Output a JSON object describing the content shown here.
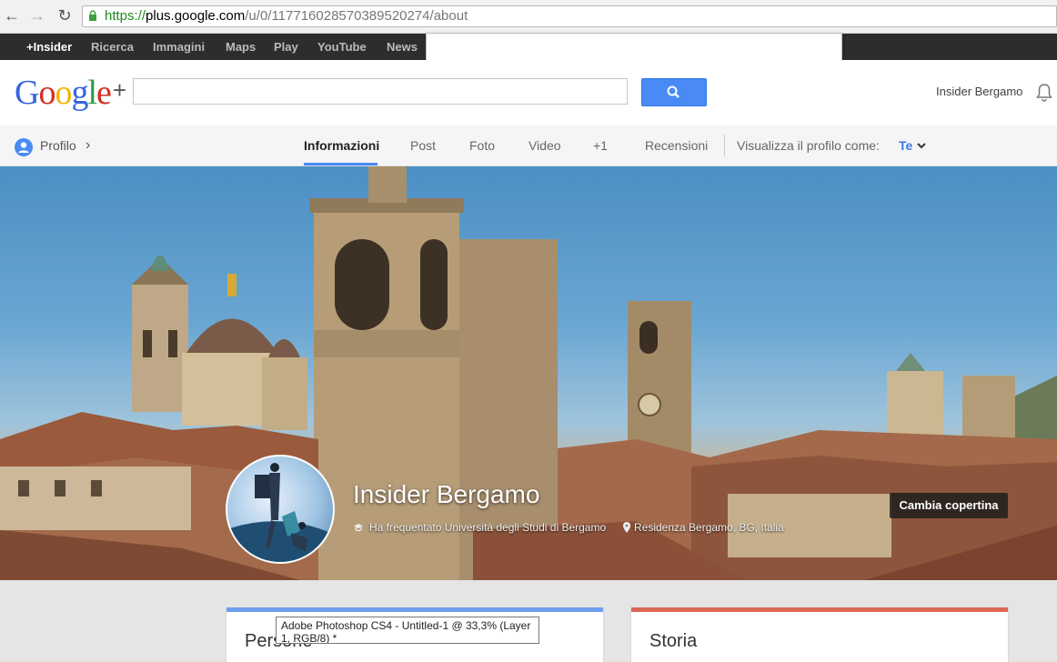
{
  "browser": {
    "back_icon": "arrow-left-icon",
    "forward_icon": "arrow-right-icon",
    "reload_icon": "reload-icon",
    "url_scheme": "https://",
    "url_host": "plus.google.com",
    "url_path": "/u/0/117716028570389520274/about"
  },
  "gbar": {
    "items": [
      "+Insider",
      "Ricerca",
      "Immagini",
      "Maps",
      "Play",
      "YouTube",
      "News"
    ]
  },
  "header": {
    "logo_letters": [
      "G",
      "o",
      "o",
      "g",
      "l",
      "e"
    ],
    "logo_plus": "+",
    "search_placeholder": "",
    "username": "Insider Bergamo"
  },
  "nav": {
    "profile_label": "Profilo",
    "tabs": [
      "Informazioni",
      "Post",
      "Foto",
      "Video",
      "+1",
      "Recensioni"
    ],
    "view_as_label": "Visualizza il profilo come:",
    "view_as_value": "Te"
  },
  "cover": {
    "name": "Insider Bergamo",
    "education": "Ha frequentato Università degli Studi di Bergamo",
    "location": "Residenza Bergamo, BG, Italia",
    "change_cover": "Cambia copertina"
  },
  "cards": {
    "left_title": "Persone",
    "right_title": "Storia",
    "left_color": "#6fa0f0",
    "right_color": "#dd6655"
  },
  "tooltip": "Adobe Photoshop CS4 - Untitled-1 @ 33,3% (Layer 1, RGB/8) *",
  "colors": {
    "accent": "#4a8af4",
    "gbar": "#2d2d2d"
  }
}
